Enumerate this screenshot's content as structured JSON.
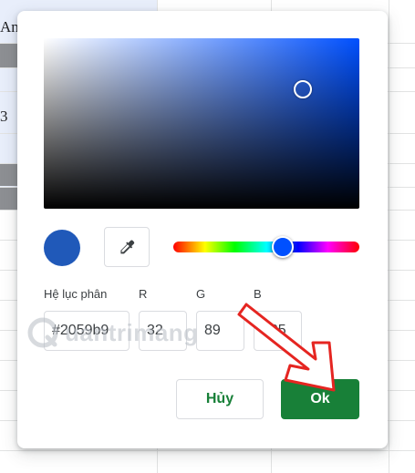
{
  "background_sheet": {
    "cell_texts": [
      "An",
      "3"
    ]
  },
  "color_picker": {
    "selected_color": "#2059b9",
    "hue_color": "#0050ff",
    "labels": {
      "hex": "Hệ lục phân",
      "r": "R",
      "g": "G",
      "b": "B"
    },
    "values": {
      "hex": "#2059b9",
      "r": "32",
      "g": "89",
      "b": "185"
    },
    "buttons": {
      "cancel": "Hủy",
      "ok": "Ok"
    },
    "accent_color": "#188038"
  },
  "watermark": {
    "text": "uantrimang",
    "logo": "Q"
  },
  "annotation": {
    "arrow_color": "#e52521"
  }
}
